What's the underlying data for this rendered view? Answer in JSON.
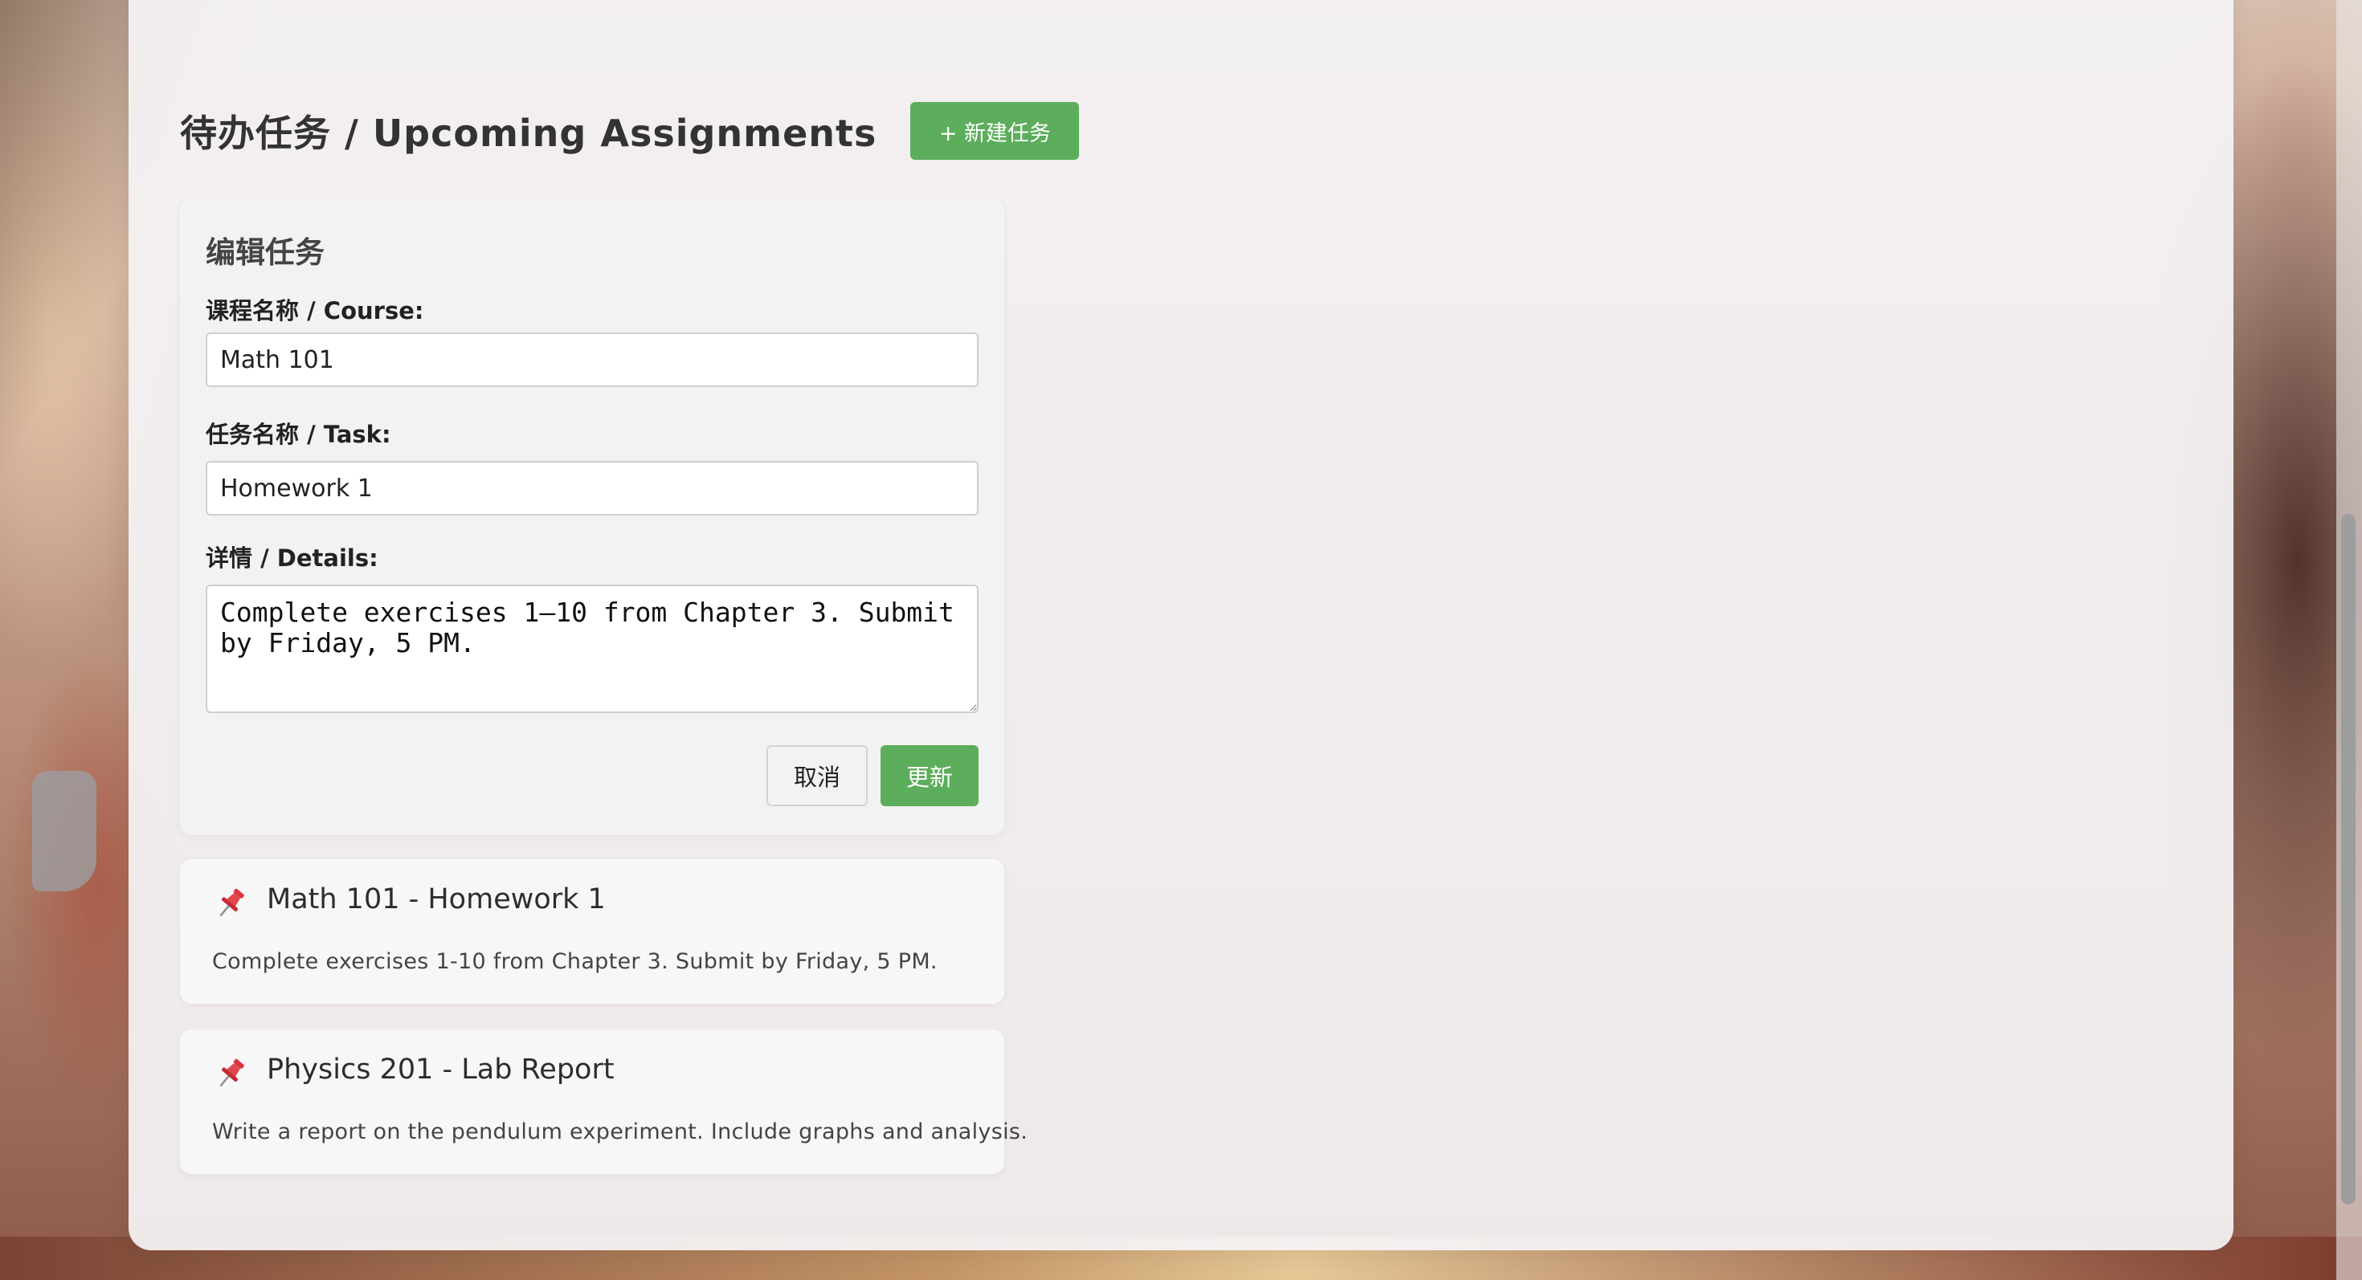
{
  "header": {
    "title": "待办任务 / Upcoming Assignments",
    "new_task_label": "+ 新建任务"
  },
  "edit_form": {
    "title": "编辑任务",
    "course_label": "课程名称 / Course:",
    "course_value": "Math 101",
    "task_label": "任务名称 / Task:",
    "task_value": "Homework 1",
    "details_label": "详情 / Details:",
    "details_value": "Complete exercises 1–10 from Chapter 3. Submit by Friday, 5 PM.",
    "cancel_label": "取消",
    "update_label": "更新"
  },
  "assignments": [
    {
      "title": "Math 101 - Homework 1",
      "description": "Complete exercises 1-10 from Chapter 3. Submit by Friday, 5 PM.",
      "icon": "pushpin-icon"
    },
    {
      "title": "Physics 201 - Lab Report",
      "description": "Write a report on the pendulum experiment. Include graphs and analysis.",
      "icon": "pushpin-icon"
    }
  ],
  "colors": {
    "accent_green": "#5cad5c",
    "card_background": "#f5f3f5",
    "pin_red": "#d9363e"
  }
}
